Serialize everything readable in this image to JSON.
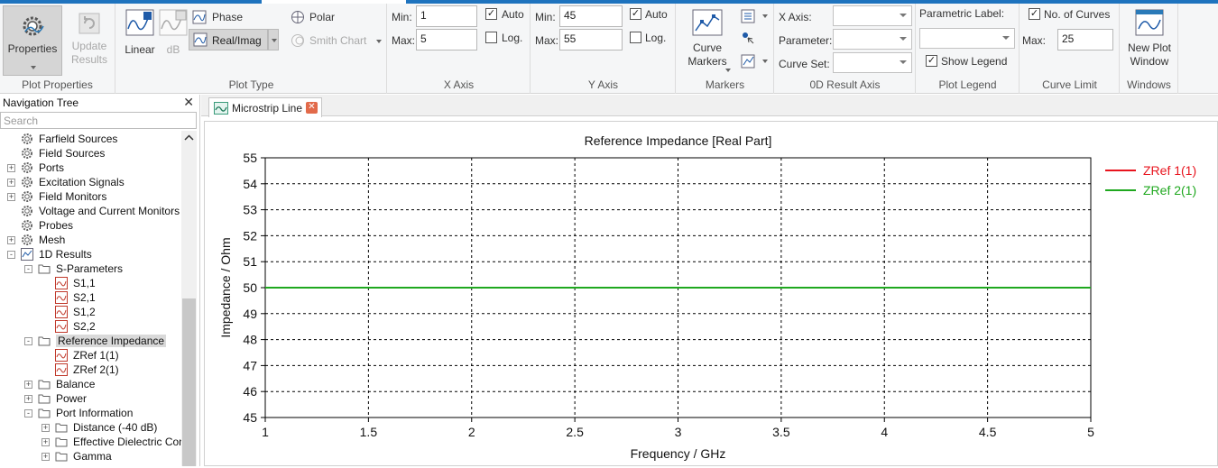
{
  "ribbon": {
    "plot_properties": {
      "properties_label": "Properties",
      "update_label": "Update",
      "update_label2": "Results",
      "group_label": "Plot Properties"
    },
    "plot_type": {
      "linear_label": "Linear",
      "db_label": "dB",
      "phase_label": "Phase",
      "realimag_label": "Real/Imag",
      "polar_label": "Polar",
      "smith_label": "Smith Chart",
      "group_label": "Plot Type"
    },
    "x_axis": {
      "min_label": "Min:",
      "max_label": "Max:",
      "min_value": "1",
      "max_value": "5",
      "auto_label": "Auto",
      "log_label": "Log.",
      "auto_checked": "✓",
      "group_label": "X Axis"
    },
    "y_axis": {
      "min_label": "Min:",
      "max_label": "Max:",
      "min_value": "45",
      "max_value": "55",
      "auto_label": "Auto",
      "log_label": "Log.",
      "auto_checked": "✓",
      "group_label": "Y Axis"
    },
    "markers": {
      "curve_label": "Curve",
      "markers_label": "Markers",
      "group_label": "Markers"
    },
    "od_result_axis": {
      "x_axis_label": "X Axis:",
      "parameter_label": "Parameter:",
      "curve_set_label": "Curve Set:",
      "group_label": "0D Result Axis"
    },
    "plot_legend": {
      "parametric_label": "Parametric Label:",
      "show_legend_label": "Show Legend",
      "show_legend_checked": "✓",
      "group_label": "Plot Legend"
    },
    "curve_limit": {
      "no_of_curves_label": "No. of Curves",
      "no_of_curves_checked": "✓",
      "max_label": "Max:",
      "max_value": "25",
      "group_label": "Curve Limit"
    },
    "windows": {
      "new_plot_label": "New Plot",
      "window_label": "Window",
      "group_label": "Windows"
    }
  },
  "nav": {
    "title": "Navigation Tree",
    "close": "✕",
    "search_placeholder": "Search",
    "items": [
      {
        "label": "Farfield Sources"
      },
      {
        "label": "Field Sources"
      },
      {
        "label": "Ports"
      },
      {
        "label": "Excitation Signals"
      },
      {
        "label": "Field Monitors"
      },
      {
        "label": "Voltage and Current Monitors"
      },
      {
        "label": "Probes"
      },
      {
        "label": "Mesh"
      },
      {
        "label": "1D Results"
      },
      {
        "label": "S-Parameters"
      },
      {
        "label": "S1,1"
      },
      {
        "label": "S2,1"
      },
      {
        "label": "S1,2"
      },
      {
        "label": "S2,2"
      },
      {
        "label": "Reference Impedance"
      },
      {
        "label": "ZRef 1(1)"
      },
      {
        "label": "ZRef 2(1)"
      },
      {
        "label": "Balance"
      },
      {
        "label": "Power"
      },
      {
        "label": "Port Information"
      },
      {
        "label": "Distance (-40 dB)"
      },
      {
        "label": "Effective Dielectric Const"
      },
      {
        "label": "Gamma"
      }
    ]
  },
  "tabs": [
    {
      "label": "Microstrip Line",
      "close": "✕"
    }
  ],
  "chart_data": {
    "type": "line",
    "title": "Reference Impedance [Real Part]",
    "xlabel": "Frequency / GHz",
    "ylabel": "Impedance / Ohm",
    "xlim": [
      1,
      5
    ],
    "ylim": [
      45,
      55
    ],
    "x_ticks": [
      "1",
      "1.5",
      "2",
      "2.5",
      "3",
      "3.5",
      "4",
      "4.5",
      "5"
    ],
    "y_ticks": [
      "45",
      "46",
      "47",
      "48",
      "49",
      "50",
      "51",
      "52",
      "53",
      "54",
      "55"
    ],
    "grid": true,
    "legend_position": "top-right",
    "series": [
      {
        "name": "ZRef 1(1)",
        "color": "#e8141e",
        "x": [
          1,
          5
        ],
        "y": [
          50,
          50
        ]
      },
      {
        "name": "ZRef 2(1)",
        "color": "#1fa81f",
        "x": [
          1,
          5
        ],
        "y": [
          50,
          50
        ]
      }
    ]
  }
}
